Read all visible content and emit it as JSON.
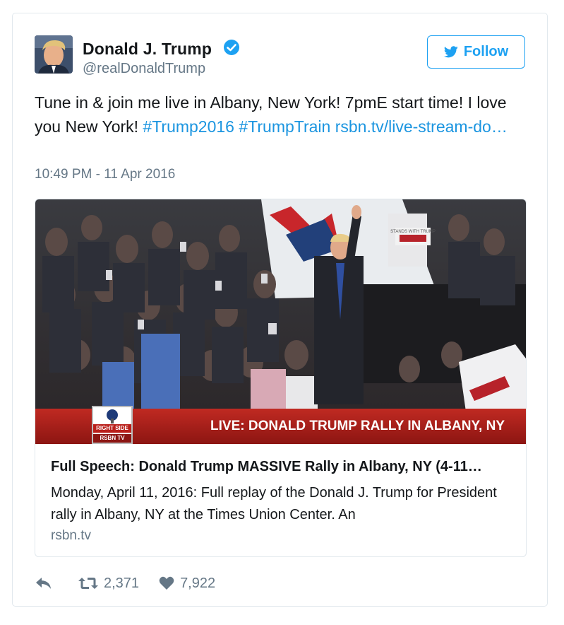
{
  "user": {
    "name": "Donald J. Trump",
    "handle": "@realDonaldTrump"
  },
  "follow_label": "Follow",
  "tweet": {
    "text_plain": "Tune in & join me live in Albany, New York! 7pmE start time! I love you New York! ",
    "hashtag1": "#Trump2016",
    "hashtag2": "#TrumpTrain",
    "link": "rsbn.tv/live-stream-do…",
    "timestamp": "10:49 PM - 11 Apr 2016"
  },
  "card": {
    "banner_text": "LIVE: DONALD TRUMP RALLY IN ALBANY, NY",
    "logo_text": "RIGHT SIDE",
    "logo_subtext": "RSBN TV",
    "sign_text": "STANDS WITH TRUMP",
    "title": "Full Speech: Donald Trump MASSIVE Rally in Albany, NY (4-11…",
    "description": "Monday, April 11, 2016: Full replay of the Donald J. Trump for President rally in Albany, NY at the Times Union Center. An",
    "domain": "rsbn.tv"
  },
  "actions": {
    "retweets": "2,371",
    "likes": "7,922"
  },
  "colors": {
    "accent": "#1da1f2",
    "link": "#1b95e0",
    "muted": "#657786",
    "banner_red": "#b91f1a"
  }
}
